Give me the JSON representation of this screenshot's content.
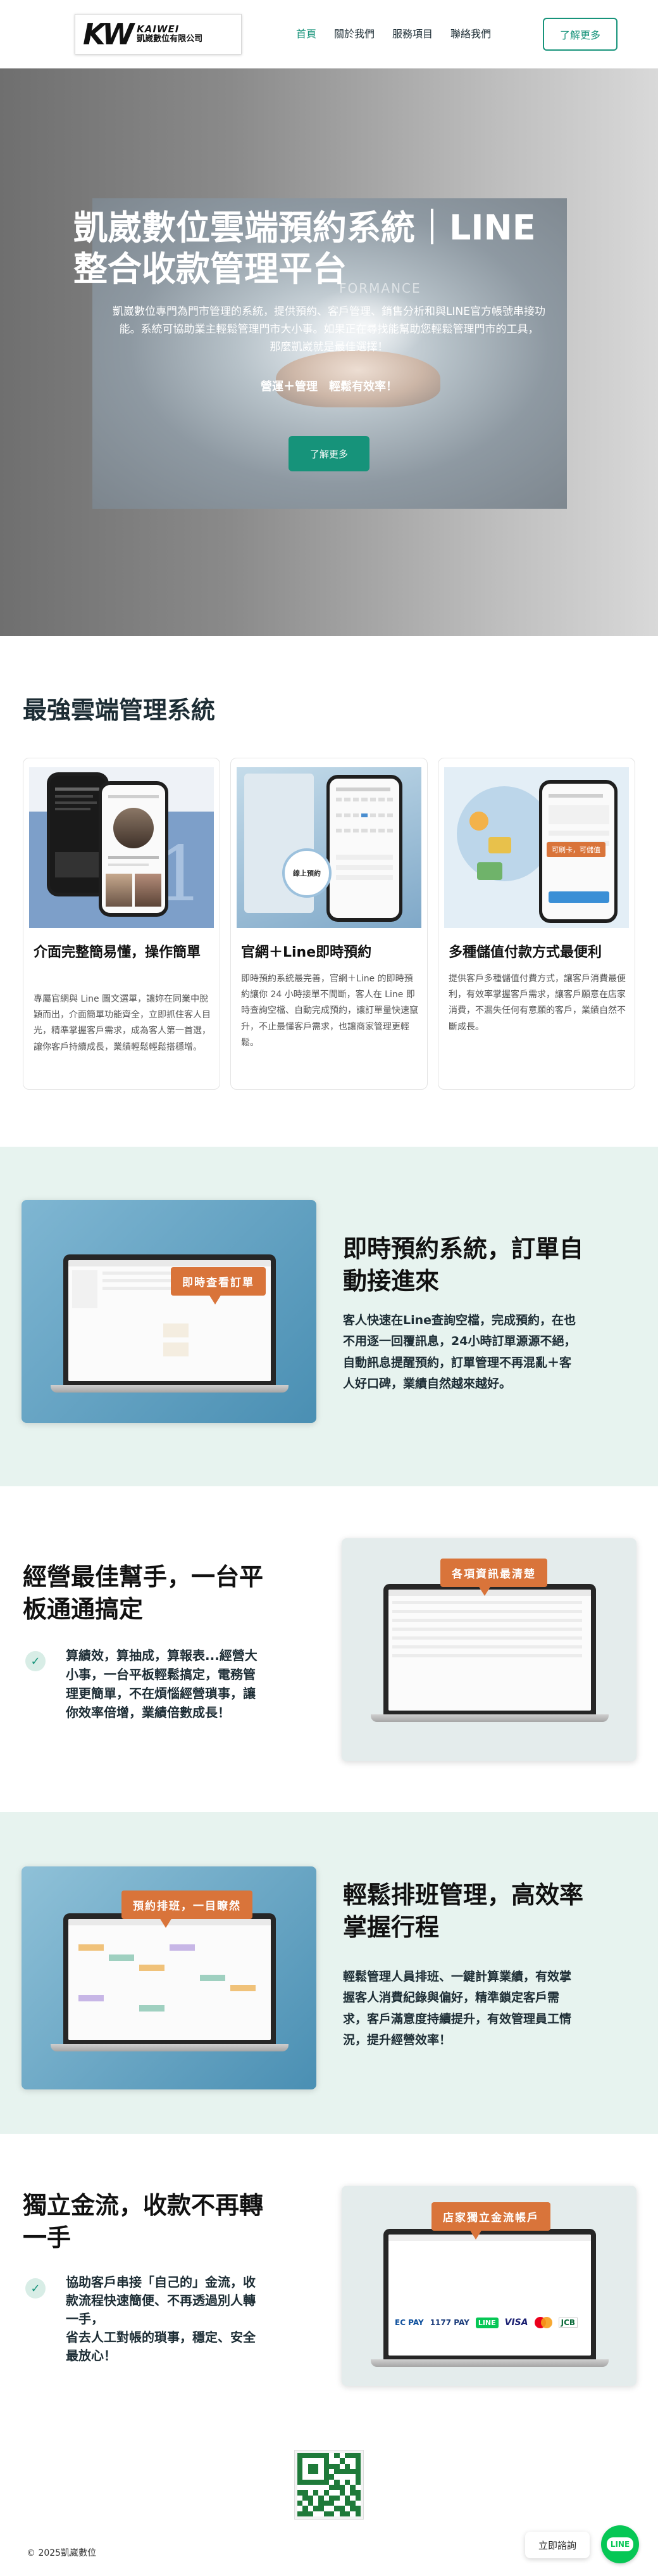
{
  "header": {
    "logo_mark": "KW",
    "logo_en": "KAIWEI",
    "logo_zh": "凱崴數位有限公司",
    "nav": [
      "首頁",
      "關於我們",
      "服務項目",
      "聯絡我們"
    ],
    "cta": "了解更多"
  },
  "hero": {
    "photo_text": "FORMANCE",
    "title_line1": "凱崴數位雲端預約系統｜LINE",
    "title_line2": "整合收款管理平台",
    "desc_line1": "凱崴數位專門為門市管理的系統，提供預約、客戶管理、銷售分析和與LINE官方帳號串接功",
    "desc_line2": "能。系統可協助業主輕鬆管理門市大小事。如果正在尋找能幫助您輕鬆管理門市的工具，",
    "desc_line3": "那麼凱崴就是最佳選擇！",
    "tagline": "營運＋管理　輕鬆有效率！",
    "button": "了解更多"
  },
  "section_cloud": {
    "title": "最強雲端管理系統",
    "cards": [
      {
        "title": "介面完整簡易懂，操作簡單",
        "text": "專屬官網與 Line 圖文選單，讓妳在同業中脫穎而出，介面簡單功能齊全，立即抓住客人目光，精準掌握客戶需求，成為客人第一首選，讓你客戶持續成長，業績輕鬆輕鬆搭穩增。"
      },
      {
        "title": "官網＋Line即時預約",
        "text": "即時預約系統最完善，官網＋Line 的即時預約讓你 24 小時接單不間斷，客人在 Line 即時查詢空檔、自動完成預約，讓訂單量快速竄升，不止最懂客戶需求，也讓商家管理更輕鬆。",
        "badge": "線上預約"
      },
      {
        "title": "多種儲值付款方式最便利",
        "text": "提供客戶多種儲值付費方式，讓客戶消費最便利，有效率掌握客戶需求，讓客戶願意在店家消費，不漏失任何有意願的客戶，業績自然不斷成長。",
        "badge": "可刷卡，可儲值"
      }
    ]
  },
  "feature_booking": {
    "bubble": "即時查看訂單",
    "title_line1": "即時預約系統，訂單自",
    "title_line2": "動接進來",
    "text_line1": "客人快速在Line查詢空檔，完成預約，在也",
    "text_line2": "不用逐一回覆訊息，24小時訂單源源不絕，",
    "text_line3": "自動訊息提醒預約，訂單管理不再混亂＋客",
    "text_line4": "人好口碑，業績自然越來越好。"
  },
  "feature_tablet": {
    "title_line1": "經營最佳幫手，一台平",
    "title_line2": "板通通搞定",
    "point_line1": "算績效，算抽成，算報表...經營大",
    "point_line2": "小事，一台平板輕鬆搞定，電務管",
    "point_line3": "理更簡單，不在煩惱經營瑣事，讓",
    "point_line4": "你效率倍增，業績倍數成長！",
    "bubble": "各項資訊最清楚"
  },
  "feature_schedule": {
    "bubble": "預約排班，一目瞭然",
    "title_line1": "輕鬆排班管理，高效率",
    "title_line2": "掌握行程",
    "text_line1": "輕鬆管理人員排班、一鍵計算業績，有效掌",
    "text_line2": "握客人消費紀錄與偏好，精準鎖定客戶需",
    "text_line3": "求，客戶滿意度持續提升，有效管理員工情",
    "text_line4": "況，提升經營效率！"
  },
  "feature_payment": {
    "title_line1": "獨立金流，收款不再轉",
    "title_line2": "一手",
    "point_line1": "協助客戶串接「自己的」金流，收",
    "point_line2": "款流程快速簡便、不再透過別人轉",
    "point_line3": "一手，",
    "point_line4": "省去人工對帳的瑣事，穩定、安全",
    "point_line5": "最放心！",
    "bubble": "店家獨立金流帳戶",
    "pay_logos": [
      "EC PAY",
      "1177 PAY",
      "LINE",
      "VISA",
      "MasterCard",
      "JCB"
    ]
  },
  "footer": {
    "copyright": "© 2025凱崴數位",
    "consult": "立即諮詢",
    "line_label": "LINE"
  },
  "colors": {
    "accent": "#16937a",
    "mint": "#e7f3ef",
    "bubble": "#d9743a",
    "line_green": "#06c755"
  }
}
